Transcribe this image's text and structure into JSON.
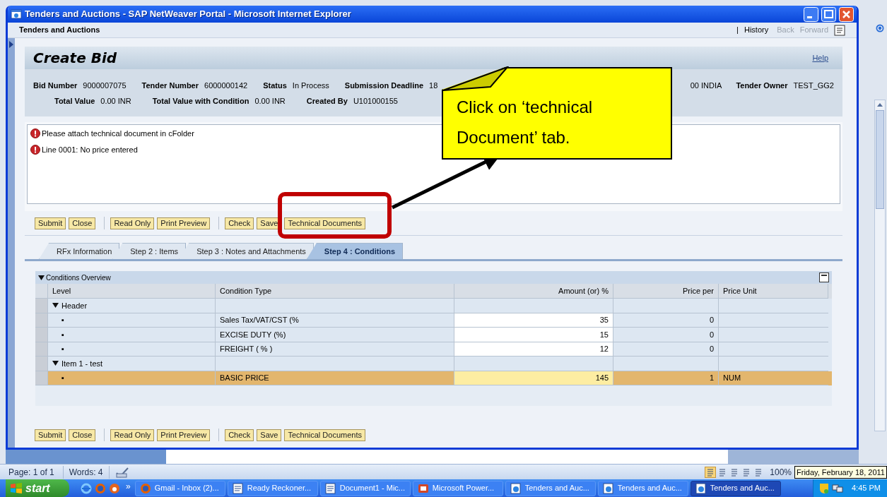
{
  "window": {
    "title": "Tenders and Auctions - SAP NetWeaver Portal - Microsoft Internet Explorer"
  },
  "portal_header": {
    "title": "Tenders and Auctions",
    "separator": "|",
    "history": "History",
    "back": "Back",
    "forward": "Forward"
  },
  "page": {
    "title": "Create Bid",
    "help": "Help"
  },
  "details_row_1": [
    {
      "label": "Bid Number",
      "value": "9000007075"
    },
    {
      "label": "Tender Number",
      "value": "6000000142"
    },
    {
      "label": "Status",
      "value": "In Process"
    },
    {
      "label": "Submission Deadline",
      "value": "18"
    }
  ],
  "details_row_1_right": [
    {
      "value": "00 INDIA"
    },
    {
      "label": "Tender Owner",
      "value": "TEST_GG2"
    }
  ],
  "details_row_2": [
    {
      "label": "Total Value",
      "value": "0.00 INR"
    },
    {
      "label": "Total Value with Condition",
      "value": "0.00 INR"
    },
    {
      "label": "Created By",
      "value": "U101000155"
    }
  ],
  "messages": [
    {
      "kind": "error",
      "text": "Please attach technical document in cFolder"
    },
    {
      "kind": "error",
      "text": "Line 0001: No price entered"
    }
  ],
  "toolbar_top": [
    [
      "Submit",
      "Close"
    ],
    [
      "Read Only",
      "Print Preview"
    ],
    [
      "Check",
      "Save",
      "Technical Documents"
    ]
  ],
  "tabs": [
    {
      "label": "RFx Information",
      "selected": false
    },
    {
      "label": "Step 2 : Items",
      "selected": false
    },
    {
      "label": "Step 3 : Notes and Attachments",
      "selected": false
    },
    {
      "label": "Step 4 : Conditions",
      "selected": true
    }
  ],
  "conditions": {
    "title": "Conditions Overview",
    "expanded": true,
    "columns": [
      "Level",
      "Condition Type",
      "Amount (or) %",
      "Price per",
      "Price Unit"
    ],
    "rows": [
      {
        "level": "Header",
        "expanded": true,
        "selected": false,
        "children": [
          {
            "level": "▪",
            "condition_type": "Sales Tax/VAT/CST (%",
            "amount": "35",
            "price_per": "0",
            "selected": false
          },
          {
            "level": "▪",
            "condition_type": "EXCISE DUTY (%)",
            "amount": "15",
            "price_per": "0",
            "selected": false
          },
          {
            "level": "▪",
            "condition_type": "FREIGHT ( % )",
            "amount": "12",
            "price_per": "0",
            "selected": false
          }
        ]
      },
      {
        "level": "Item 1 - test",
        "expanded": true,
        "selected": false,
        "children": [
          {
            "level": "▪",
            "condition_type": "BASIC PRICE",
            "amount": "145",
            "price_per": "1",
            "price_unit": "NUM",
            "selected": true
          }
        ]
      }
    ]
  },
  "toolbar_bottom": [
    [
      "Submit",
      "Close"
    ],
    [
      "Read Only",
      "Print Preview"
    ],
    [
      "Check",
      "Save",
      "Technical Documents"
    ]
  ],
  "callout": {
    "text": "Click on ‘technical Document’ tab."
  },
  "status_bar": {
    "page": "Page: 1 of 1",
    "words": "Words: 4",
    "zoom": "100%"
  },
  "tooltip": "Friday, February 18, 2011",
  "taskbar": {
    "start": "start",
    "more": "»",
    "tasks": [
      {
        "label": "Gmail - Inbox (2)...",
        "kind": "browser",
        "selected": false
      },
      {
        "label": "Ready Reckoner...",
        "kind": "document",
        "selected": false
      },
      {
        "label": "Document1 - Mic...",
        "kind": "document",
        "selected": false
      },
      {
        "label": "Microsoft Power...",
        "kind": "slides",
        "selected": false
      },
      {
        "label": "Tenders and Auc...",
        "kind": "web",
        "selected": false
      },
      {
        "label": "Tenders and Auc...",
        "kind": "web",
        "selected": false
      },
      {
        "label": "Tenders and Auc...",
        "kind": "web",
        "selected": true
      }
    ],
    "clock": "4:45 PM"
  }
}
